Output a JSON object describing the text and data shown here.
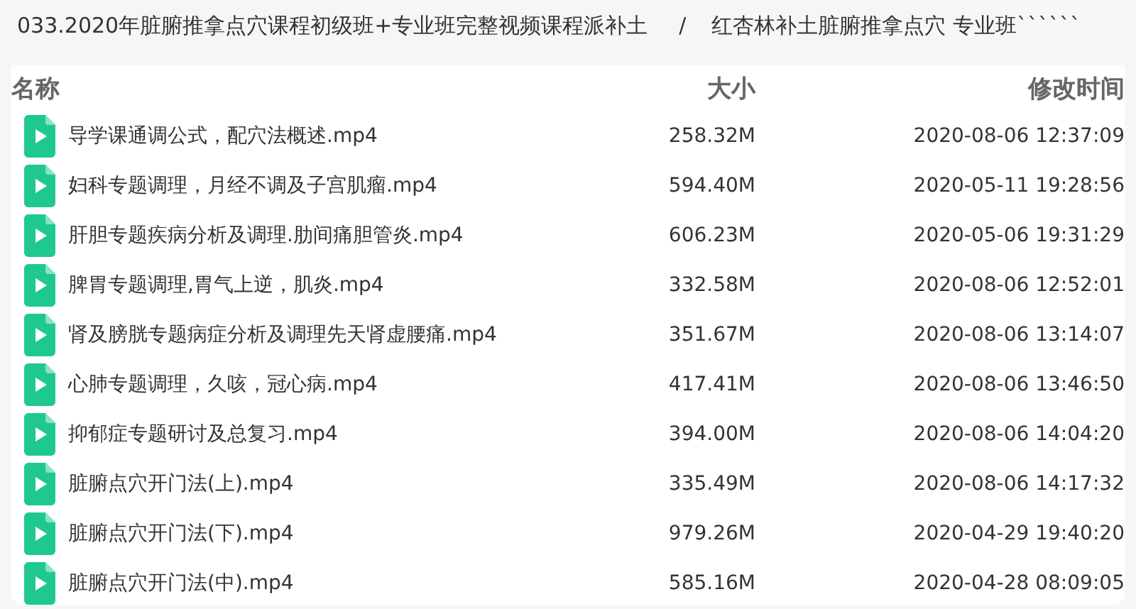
{
  "breadcrumb": {
    "items": [
      "033.2020年脏腑推拿点穴课程初级班+专业班完整视频课程派补土",
      "红杏林补土脏腑推拿点穴 专业班``````"
    ],
    "separator": "/"
  },
  "table": {
    "columns": [
      "名称",
      "大小",
      "修改时间"
    ],
    "rows": [
      {
        "kind": "video",
        "name": "导学课通调公式，配穴法概述.mp4",
        "size": "258.32M",
        "modified": "2020-08-06 12:37:09"
      },
      {
        "kind": "video",
        "name": "妇科专题调理，月经不调及子宫肌瘤.mp4",
        "size": "594.40M",
        "modified": "2020-05-11 19:28:56"
      },
      {
        "kind": "video",
        "name": "肝胆专题疾病分析及调理.肋间痛胆管炎.mp4",
        "size": "606.23M",
        "modified": "2020-05-06 19:31:29"
      },
      {
        "kind": "video",
        "name": "脾胃专题调理,胃气上逆，肌炎.mp4",
        "size": "332.58M",
        "modified": "2020-08-06 12:52:01"
      },
      {
        "kind": "video",
        "name": "肾及膀胱专题病症分析及调理先天肾虚腰痛.mp4",
        "size": "351.67M",
        "modified": "2020-08-06 13:14:07"
      },
      {
        "kind": "video",
        "name": "心肺专题调理，久咳，冠心病.mp4",
        "size": "417.41M",
        "modified": "2020-08-06 13:46:50"
      },
      {
        "kind": "video",
        "name": "抑郁症专题研讨及总复习.mp4",
        "size": "394.00M",
        "modified": "2020-08-06 14:04:20"
      },
      {
        "kind": "video",
        "name": "脏腑点穴开门法(上).mp4",
        "size": "335.49M",
        "modified": "2020-08-06 14:17:32"
      },
      {
        "kind": "video",
        "name": "脏腑点穴开门法(下).mp4",
        "size": "979.26M",
        "modified": "2020-04-29 19:40:20"
      },
      {
        "kind": "video",
        "name": "脏腑点穴开门法(中).mp4",
        "size": "585.16M",
        "modified": "2020-04-28 08:09:05"
      }
    ]
  }
}
